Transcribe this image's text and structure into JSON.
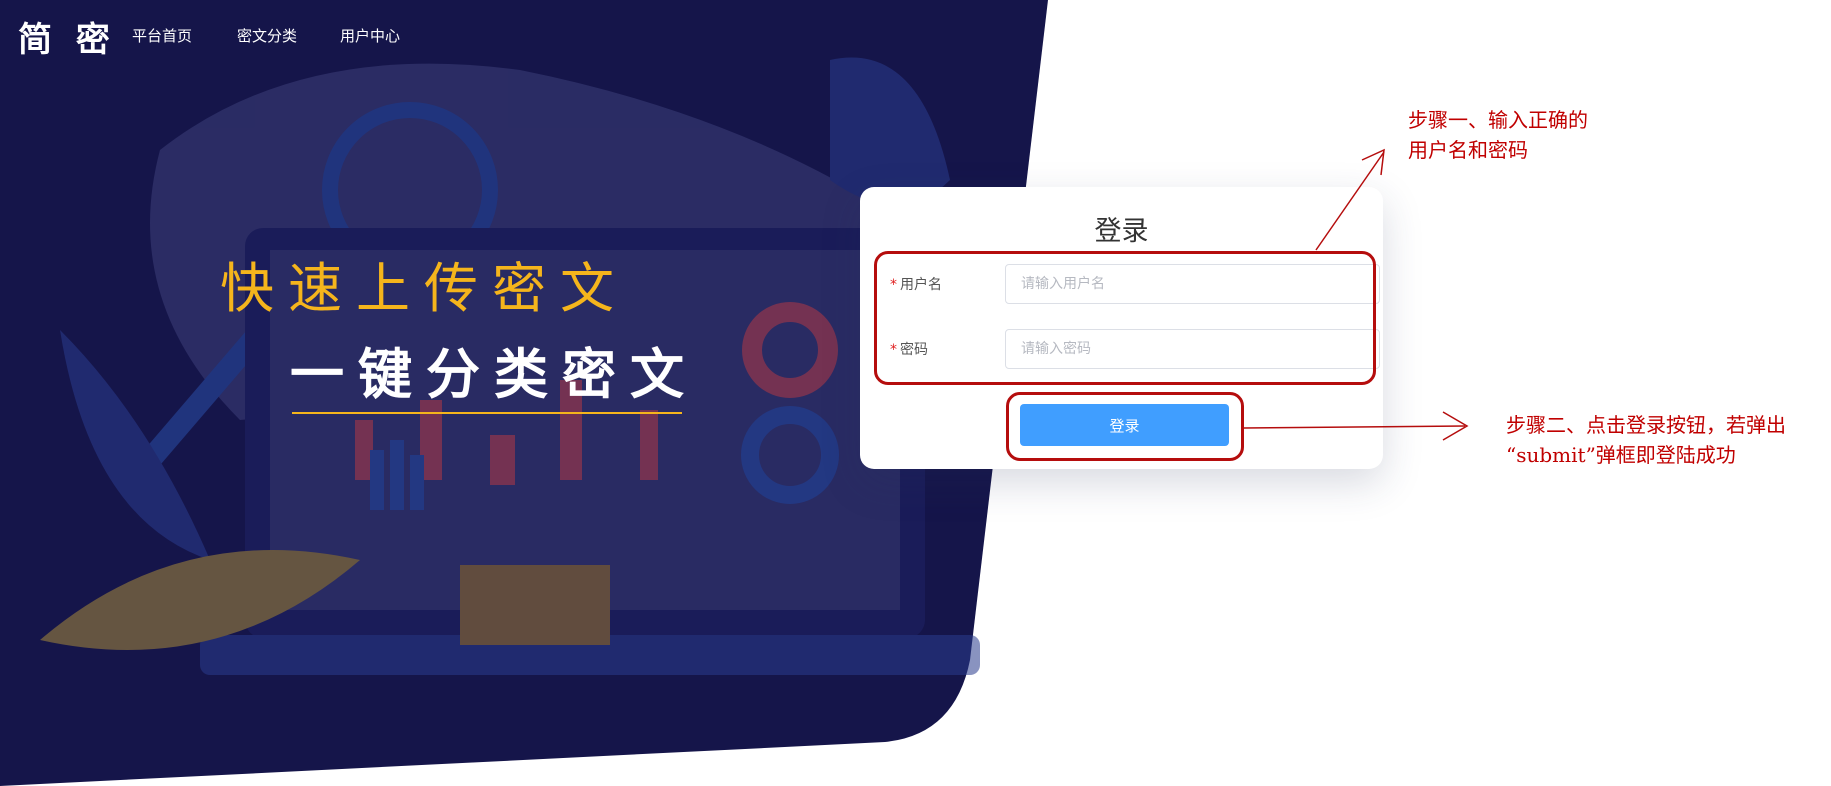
{
  "brand": {
    "logo": "简 密"
  },
  "nav": {
    "items": [
      "平台首页",
      "密文分类",
      "用户中心"
    ]
  },
  "hero": {
    "slogan_primary": "快速上传密文",
    "slogan_secondary": "一键分类密文"
  },
  "login": {
    "title": "登录",
    "username": {
      "label": "用户名",
      "placeholder": "请输入用户名",
      "value": ""
    },
    "password": {
      "label": "密码",
      "placeholder": "请输入密码",
      "value": ""
    },
    "required_mark": "*",
    "submit_label": "登录"
  },
  "annotations": {
    "step1_line1": "步骤一、输入正确的",
    "step1_line2": "用户名和密码",
    "step2_line1": "步骤二、点击登录按钮，若弹出",
    "step2_line2": "“submit”弹框即登陆成功"
  },
  "colors": {
    "hero_bg": "#15154a",
    "accent_yellow": "#f5b51c",
    "button_blue": "#409eff",
    "annotation_red": "#c00000"
  }
}
